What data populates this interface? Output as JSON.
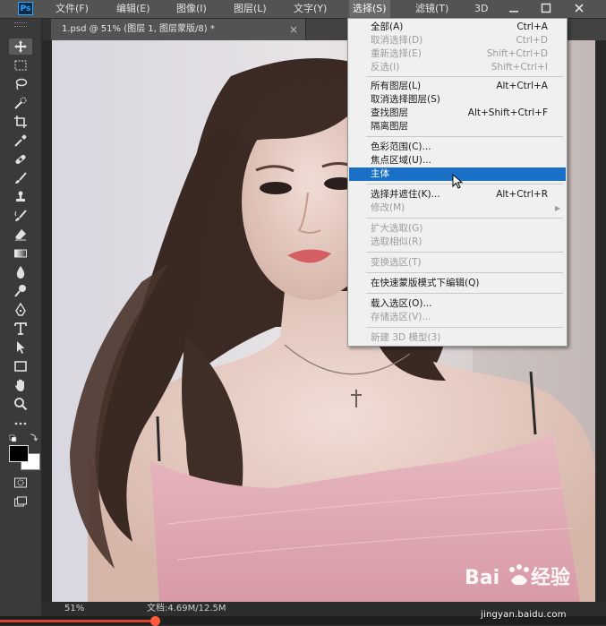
{
  "app": {
    "logo_text": "Ps"
  },
  "menubar": {
    "items": [
      {
        "label": "文件(F)"
      },
      {
        "label": "编辑(E)"
      },
      {
        "label": "图像(I)"
      },
      {
        "label": "图层(L)"
      },
      {
        "label": "文字(Y)"
      },
      {
        "label": "选择(S)",
        "open": true
      },
      {
        "label": "滤镜(T)"
      },
      {
        "label": "3D"
      }
    ]
  },
  "document_tab": {
    "title": "1.psd @ 51% (图层 1, 图层蒙版/8) *",
    "close": "×"
  },
  "select_menu": {
    "items": [
      {
        "label": "全部(A)",
        "shortcut": "Ctrl+A",
        "enabled": true
      },
      {
        "label": "取消选择(D)",
        "shortcut": "Ctrl+D",
        "enabled": false
      },
      {
        "label": "重新选择(E)",
        "shortcut": "Shift+Ctrl+D",
        "enabled": false
      },
      {
        "label": "反选(I)",
        "shortcut": "Shift+Ctrl+I",
        "enabled": false
      },
      {
        "label": "所有图层(L)",
        "shortcut": "Alt+Ctrl+A",
        "enabled": true
      },
      {
        "label": "取消选择图层(S)",
        "shortcut": "",
        "enabled": true
      },
      {
        "label": "查找图层",
        "shortcut": "Alt+Shift+Ctrl+F",
        "enabled": true
      },
      {
        "label": "隔离图层",
        "shortcut": "",
        "enabled": true
      },
      {
        "label": "色彩范围(C)...",
        "shortcut": "",
        "enabled": true
      },
      {
        "label": "焦点区域(U)...",
        "shortcut": "",
        "enabled": true
      },
      {
        "label": "主体",
        "shortcut": "",
        "enabled": true,
        "highlighted": true
      },
      {
        "label": "选择并遮住(K)...",
        "shortcut": "Alt+Ctrl+R",
        "enabled": true
      },
      {
        "label": "修改(M)",
        "shortcut": "",
        "enabled": false,
        "submenu": true
      },
      {
        "label": "扩大选取(G)",
        "shortcut": "",
        "enabled": false
      },
      {
        "label": "选取相似(R)",
        "shortcut": "",
        "enabled": false
      },
      {
        "label": "变换选区(T)",
        "shortcut": "",
        "enabled": false
      },
      {
        "label": "在快速蒙版模式下编辑(Q)",
        "shortcut": "",
        "enabled": true
      },
      {
        "label": "载入选区(O)...",
        "shortcut": "",
        "enabled": true
      },
      {
        "label": "存储选区(V)...",
        "shortcut": "",
        "enabled": false
      },
      {
        "label": "新建 3D 模型(3)",
        "shortcut": "",
        "enabled": false
      }
    ]
  },
  "statusbar": {
    "zoom": "51%",
    "doc_info": "文档:4.69M/12.5M"
  },
  "watermark": {
    "site": "jingyan.baidu.com"
  },
  "colors": {
    "menubar": "#535353",
    "highlight": "#1a6fc7",
    "menu_bg": "#f0f0f0",
    "progress": "#d9432f"
  }
}
